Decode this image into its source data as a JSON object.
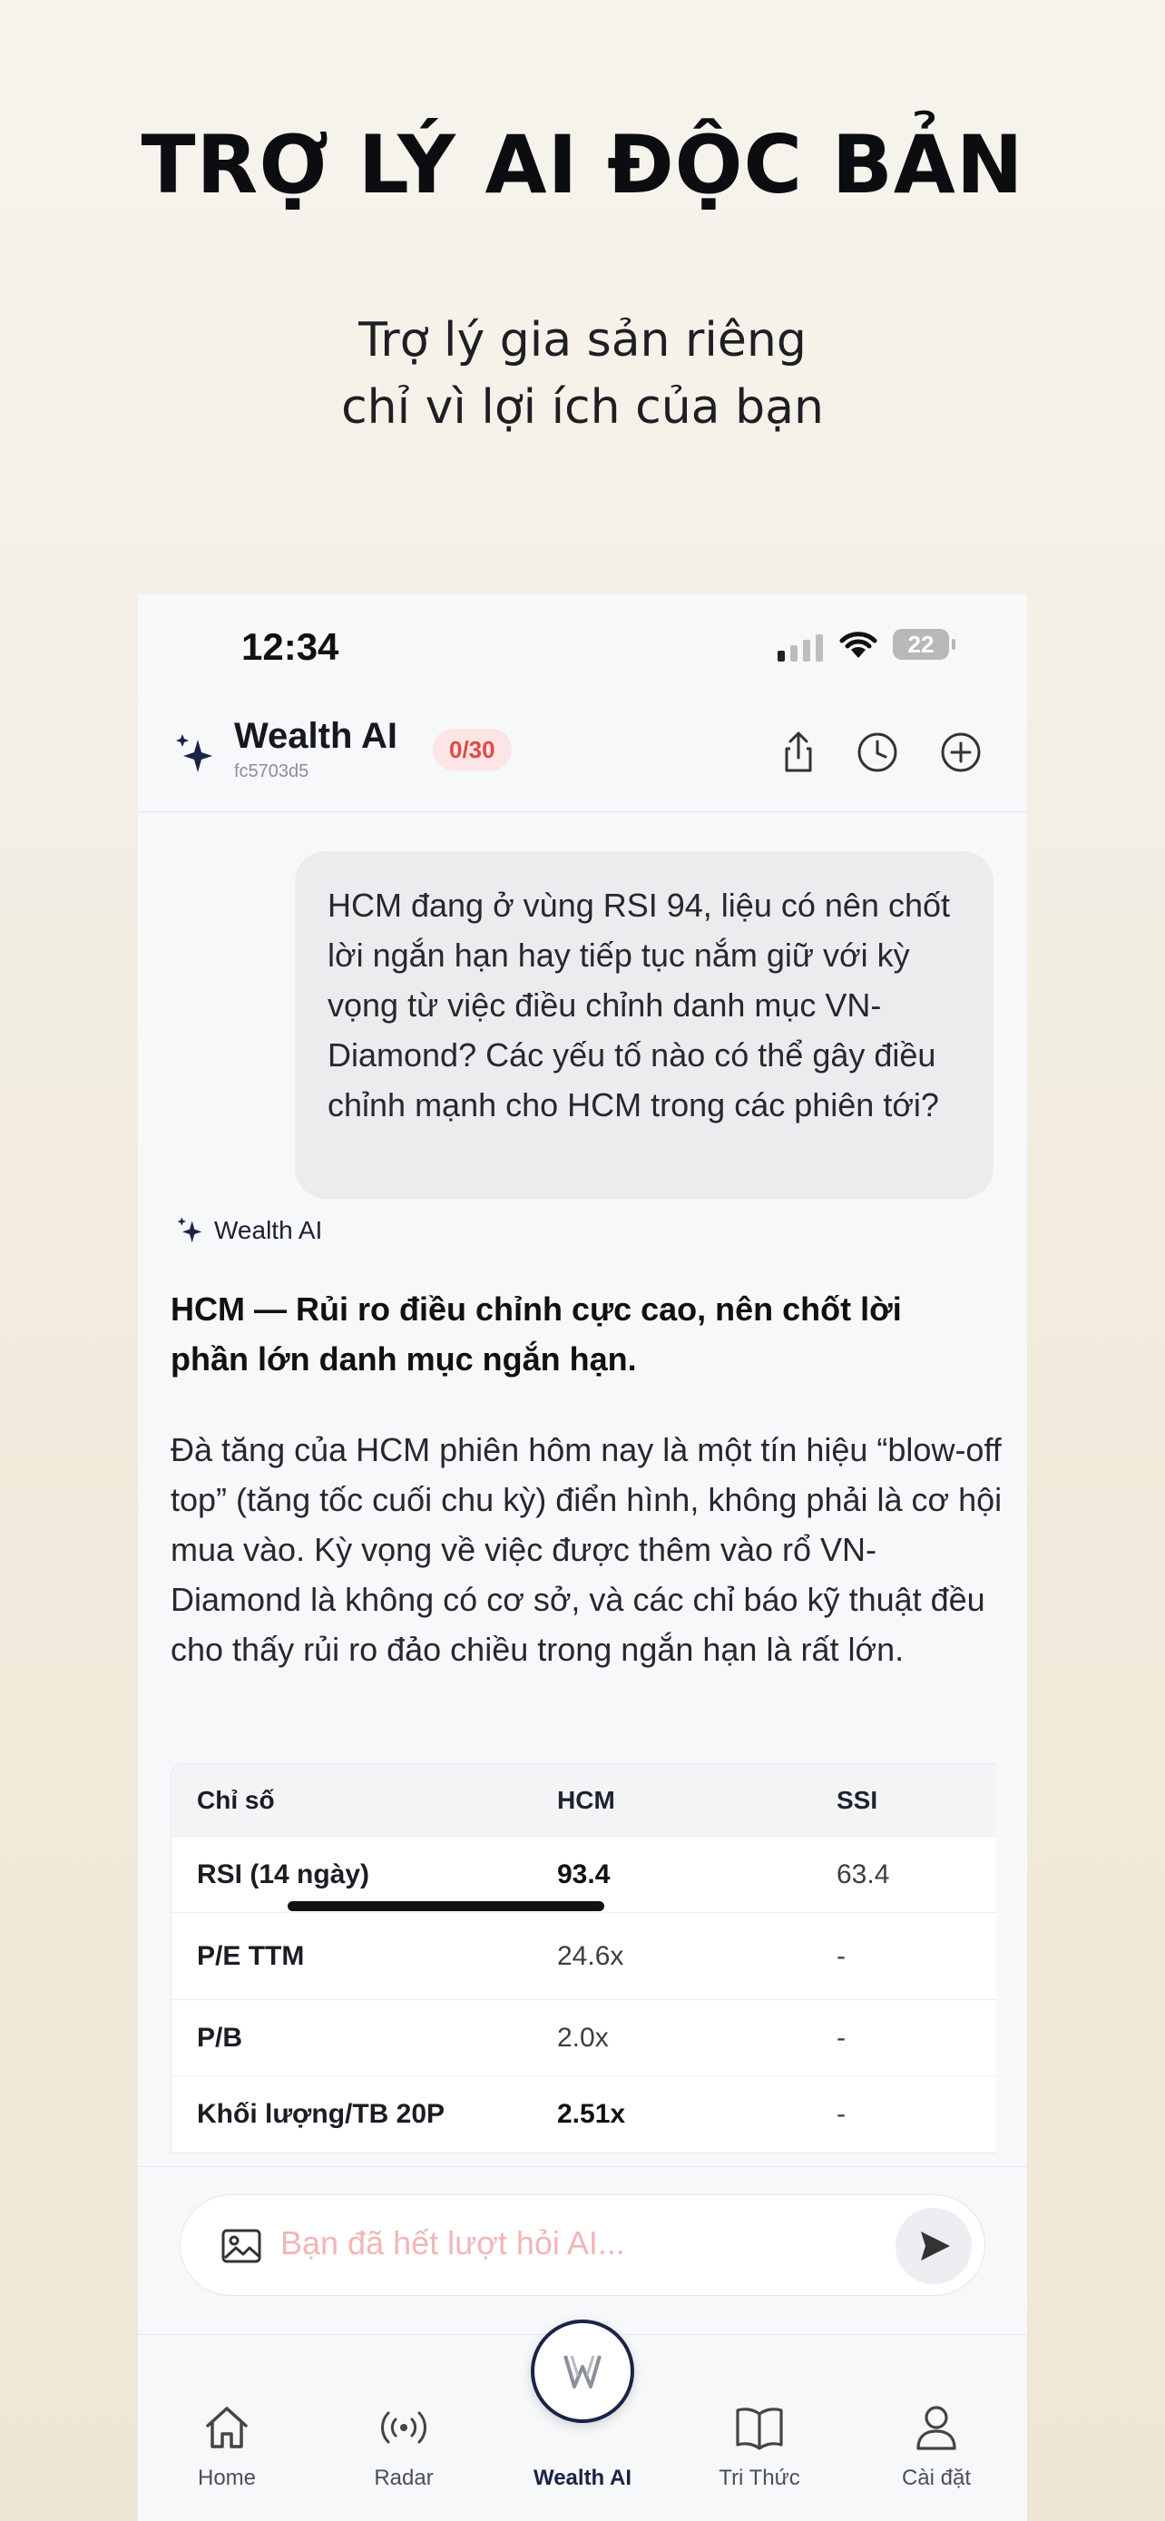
{
  "hero": {
    "title": "TRỢ LÝ AI ĐỘC BẢN",
    "subtitle_line1": "Trợ lý gia sản riêng",
    "subtitle_line2": "chỉ vì lợi ích của bạn"
  },
  "status_bar": {
    "time": "12:34",
    "battery": "22"
  },
  "header": {
    "title": "Wealth AI",
    "session_id": "fc5703d5",
    "quota": "0/30",
    "icons": [
      "share-icon",
      "history-icon",
      "new-chat-icon"
    ]
  },
  "chat": {
    "user_message": "HCM đang ở vùng RSI 94, liệu có nên chốt lời ngắn hạn hay tiếp tục nắm giữ với kỳ vọng từ việc điều chỉnh danh mục VN-Diamond? Các yếu tố nào có thể gây điều chỉnh mạnh cho HCM trong các phiên tới?",
    "ai_label": "Wealth AI",
    "ai_heading": "HCM — Rủi ro điều chỉnh cực cao, nên chốt lời phần lớn danh mục ngắn hạn.",
    "ai_paragraph": "Đà tăng của HCM phiên hôm nay là một tín hiệu “blow-off top” (tăng tốc cuối chu kỳ) điển hình, không phải là cơ hội mua vào. Kỳ vọng về việc được thêm vào rổ VN-Diamond là không có cơ sở, và các chỉ báo kỹ thuật đều cho thấy rủi ro đảo chiều trong ngắn hạn là rất lớn.",
    "table": {
      "headers": [
        "Chỉ số",
        "HCM",
        "SSI"
      ],
      "rows": [
        [
          "RSI (14 ngày)",
          "93.4",
          "63.4"
        ],
        [
          "P/E TTM",
          "24.6x",
          "-"
        ],
        [
          "P/B",
          "2.0x",
          "-"
        ],
        [
          "Khối lượng/TB 20P",
          "2.51x",
          "-"
        ]
      ]
    }
  },
  "composer": {
    "placeholder": "Bạn đã hết lượt hỏi AI..."
  },
  "tabs": [
    {
      "label": "Home",
      "icon": "home-icon"
    },
    {
      "label": "Radar",
      "icon": "radar-icon"
    },
    {
      "label": "Wealth AI",
      "icon": "wealth-ai-logo-icon"
    },
    {
      "label": "Tri Thức",
      "icon": "book-icon"
    },
    {
      "label": "Cài đặt",
      "icon": "user-icon"
    }
  ]
}
